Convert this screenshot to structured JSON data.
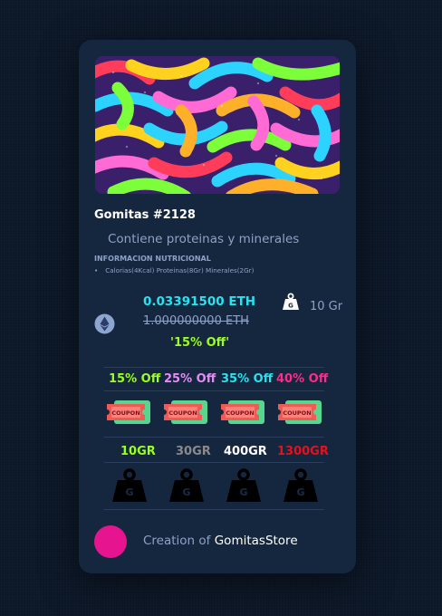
{
  "card": {
    "title": "Gomitas #2128",
    "subtitle": "Contiene proteinas y minerales",
    "nutrition_heading": "INFORMACION NUTRICIONAL",
    "nutrition_items": [
      "Calorias(4Kcal) Proteinas(8Gr) Minerales(2Gr)"
    ],
    "price": "0.03391500 ETH",
    "old_price": "1.000000000 ETH",
    "discount": "'15% Off'",
    "weight": "10 Gr"
  },
  "offers": [
    {
      "label": "15% Off",
      "color": "#9aff1f",
      "coupon_text": "COUPON"
    },
    {
      "label": "25% Off",
      "color": "#e58bf5",
      "coupon_text": "COUPON"
    },
    {
      "label": "35% Off",
      "color": "#27e3ee",
      "coupon_text": "COUPON"
    },
    {
      "label": "40% Off",
      "color": "#ff2a8a",
      "coupon_text": "COUPON"
    }
  ],
  "weights": [
    {
      "label": "10GR",
      "color": "#9aff1f"
    },
    {
      "label": "30GR",
      "color": "#8a8a8a"
    },
    {
      "label": "400GR",
      "color": "#ffffff"
    },
    {
      "label": "1300GR",
      "color": "#e8101a"
    }
  ],
  "footer": {
    "prefix": "Creation of ",
    "store": "GomitasStore"
  },
  "icons": {
    "eth": "ethereum-icon",
    "weight": "weight-icon",
    "coupon": "coupon-icon",
    "avatar": "creator-avatar"
  }
}
